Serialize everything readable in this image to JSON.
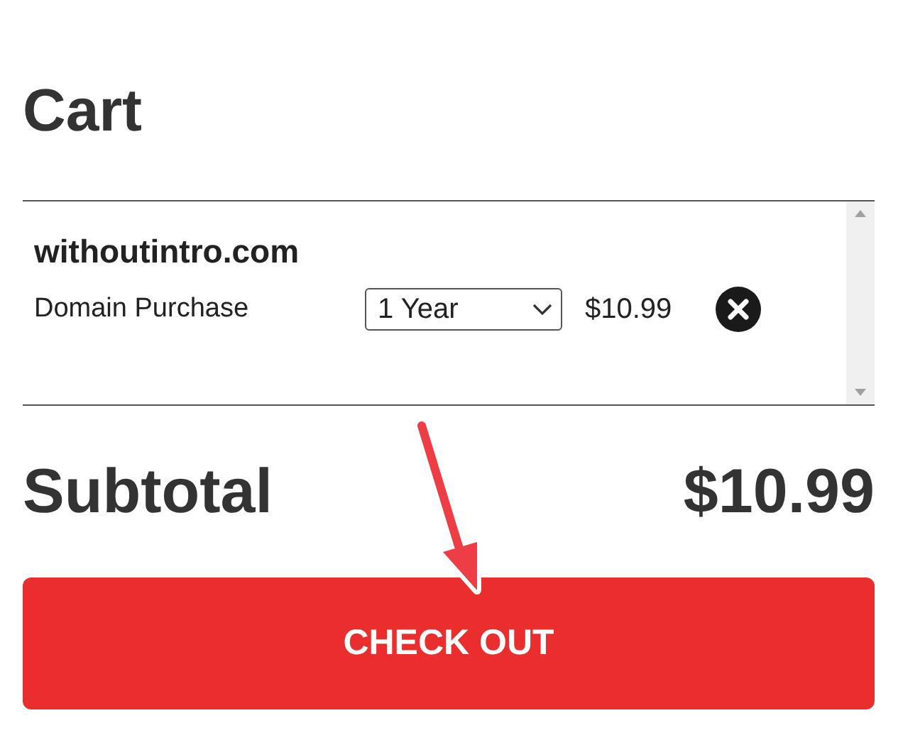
{
  "title": "Cart",
  "items": [
    {
      "domain": "withoutintro.com",
      "product": "Domain Purchase",
      "term": "1 Year",
      "price": "$10.99"
    }
  ],
  "subtotal": {
    "label": "Subtotal",
    "amount": "$10.99"
  },
  "checkout_button": "CHECK OUT"
}
